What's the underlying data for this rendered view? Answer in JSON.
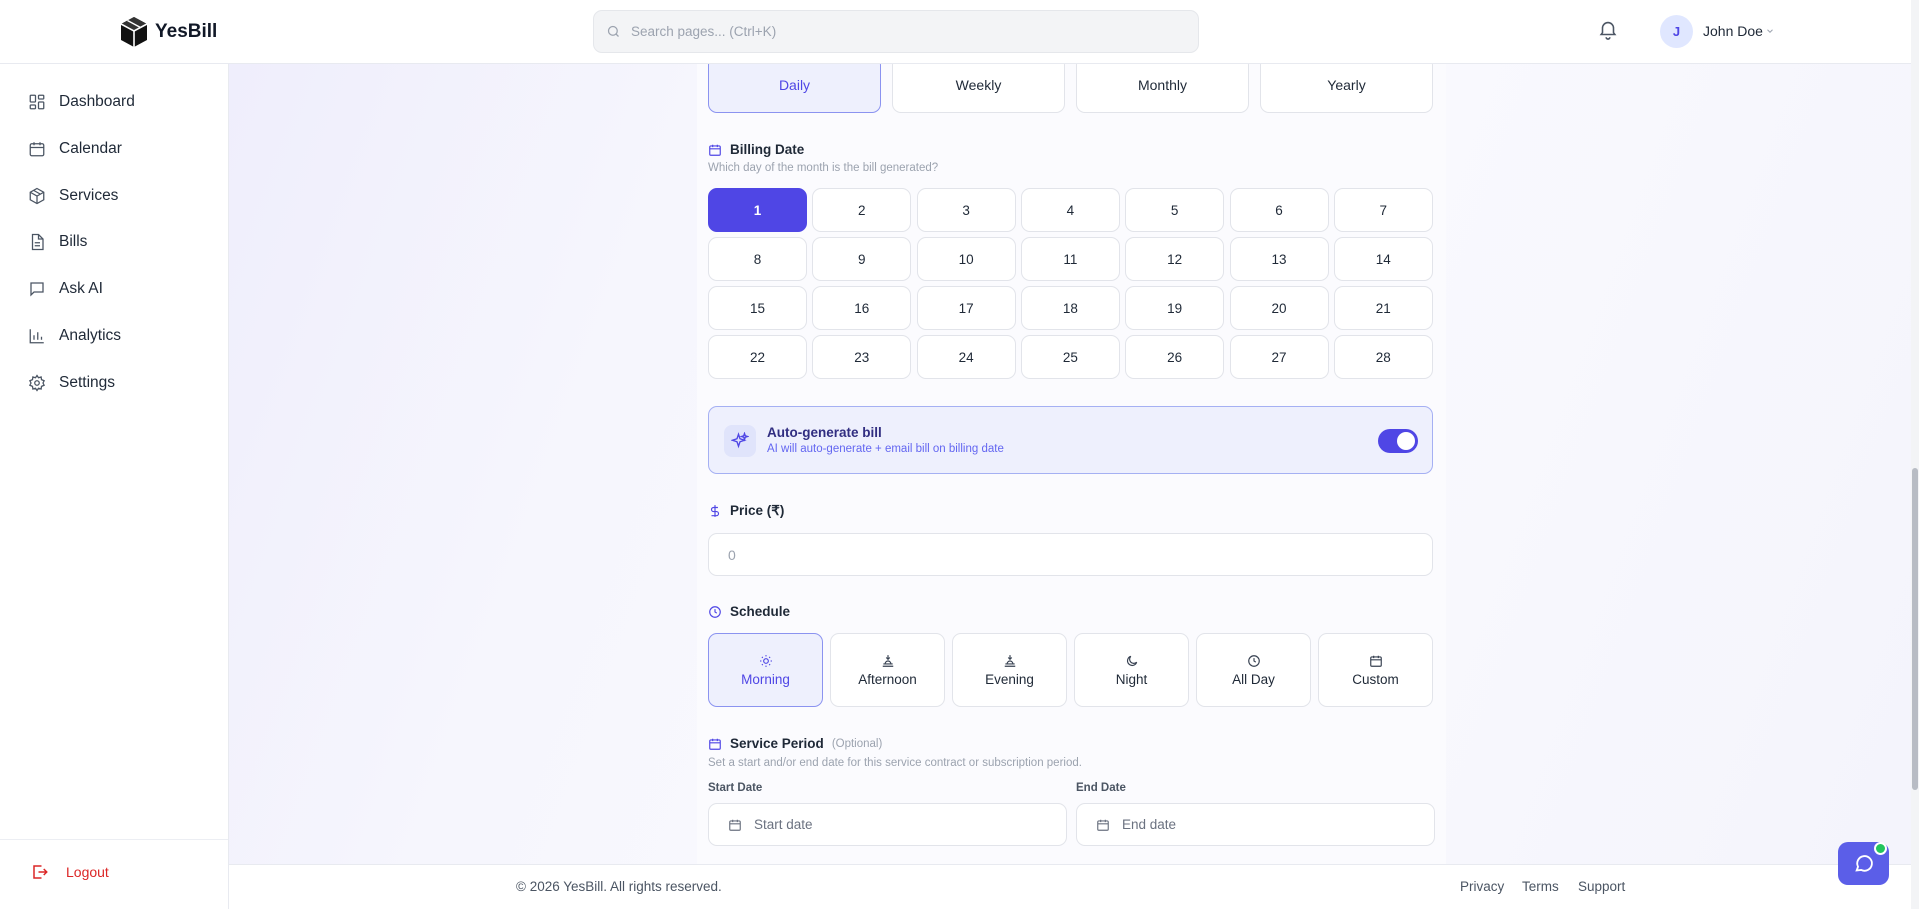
{
  "app": {
    "name": "YesBill"
  },
  "search": {
    "placeholder": "Search pages... (Ctrl+K)"
  },
  "user": {
    "initial": "J",
    "name": "John Doe"
  },
  "sidebar": {
    "items": [
      {
        "label": "Dashboard",
        "icon": "dashboard-icon"
      },
      {
        "label": "Calendar",
        "icon": "calendar-icon"
      },
      {
        "label": "Services",
        "icon": "box-icon"
      },
      {
        "label": "Bills",
        "icon": "document-icon"
      },
      {
        "label": "Ask AI",
        "icon": "chat-icon"
      },
      {
        "label": "Analytics",
        "icon": "bar-chart-icon"
      },
      {
        "label": "Settings",
        "icon": "gear-icon"
      }
    ],
    "logout_label": "Logout"
  },
  "frequency": {
    "options": [
      "Daily",
      "Weekly",
      "Monthly",
      "Yearly"
    ],
    "selected": "Daily"
  },
  "billing_date": {
    "title": "Billing Date",
    "subtitle": "Which day of the month is the bill generated?",
    "days": [
      "1",
      "2",
      "3",
      "4",
      "5",
      "6",
      "7",
      "8",
      "9",
      "10",
      "11",
      "12",
      "13",
      "14",
      "15",
      "16",
      "17",
      "18",
      "19",
      "20",
      "21",
      "22",
      "23",
      "24",
      "25",
      "26",
      "27",
      "28"
    ],
    "selected": "1"
  },
  "auto_generate": {
    "title": "Auto-generate bill",
    "subtitle": "AI will auto-generate + email bill on billing date",
    "enabled": true
  },
  "price": {
    "label": "Price (₹)",
    "placeholder": "0"
  },
  "schedule": {
    "title": "Schedule",
    "options": [
      {
        "label": "Morning",
        "icon": "sun-icon"
      },
      {
        "label": "Afternoon",
        "icon": "sun-horizon-icon"
      },
      {
        "label": "Evening",
        "icon": "sunset-icon"
      },
      {
        "label": "Night",
        "icon": "moon-icon"
      },
      {
        "label": "All Day",
        "icon": "clock-icon"
      },
      {
        "label": "Custom",
        "icon": "calendar-icon"
      }
    ],
    "selected": "Morning"
  },
  "service_period": {
    "title": "Service Period",
    "optional": "(Optional)",
    "subtitle": "Set a start and/or end date for this service contract or subscription period.",
    "start_label": "Start Date",
    "start_placeholder": "Start date",
    "end_label": "End Date",
    "end_placeholder": "End date"
  },
  "footer": {
    "copyright": "© 2026 YesBill. All rights reserved.",
    "links": [
      "Privacy",
      "Terms",
      "Support"
    ]
  },
  "colors": {
    "accent": "#4f46e5",
    "logout": "#dc2626",
    "online": "#22c55e"
  }
}
